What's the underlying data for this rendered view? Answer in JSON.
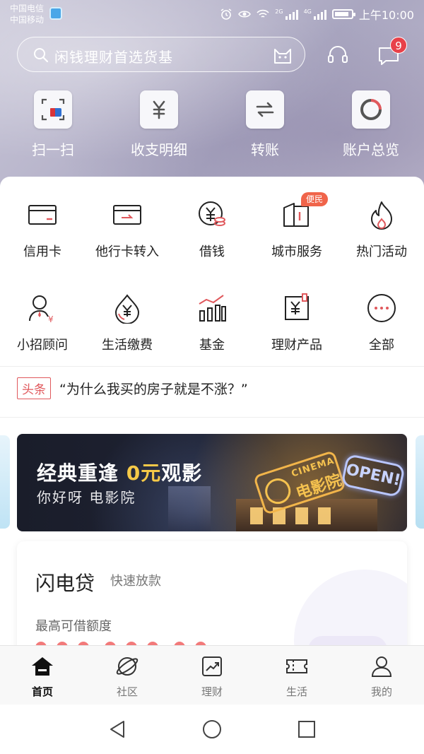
{
  "statusbar": {
    "carrier_1": "中国电信",
    "carrier_2": "中国移动",
    "net_1": "2G",
    "net_2": "4G",
    "time": "上午10:00",
    "battery_percent": 85
  },
  "search": {
    "placeholder": "闲钱理财首选货基",
    "message_badge": "9"
  },
  "quick_actions": [
    {
      "label": "扫一扫",
      "icon": "scan-icon"
    },
    {
      "label": "收支明细",
      "icon": "yuan-statement-icon"
    },
    {
      "label": "转账",
      "icon": "transfer-icon"
    },
    {
      "label": "账户总览",
      "icon": "account-overview-icon"
    }
  ],
  "services": [
    {
      "label": "信用卡",
      "icon": "credit-card-icon"
    },
    {
      "label": "他行卡转入",
      "icon": "card-transfer-in-icon"
    },
    {
      "label": "借钱",
      "icon": "borrow-coin-icon"
    },
    {
      "label": "城市服务",
      "icon": "city-service-icon",
      "tag": "便民"
    },
    {
      "label": "热门活动",
      "icon": "flame-icon"
    },
    {
      "label": "小招顾问",
      "icon": "advisor-icon"
    },
    {
      "label": "生活缴费",
      "icon": "utility-pay-icon"
    },
    {
      "label": "基金",
      "icon": "fund-chart-icon"
    },
    {
      "label": "理财产品",
      "icon": "wealth-product-icon"
    },
    {
      "label": "全部",
      "icon": "more-icon"
    }
  ],
  "headline": {
    "tag": "头条",
    "text": "“为什么我买的房子就是不涨？”"
  },
  "banner": {
    "title_pre": "经典重逢 ",
    "title_highlight": "0元",
    "title_post": "观影",
    "subtitle": "你好呀 电影院",
    "sign_word": "CINEMA",
    "sign_cn": "电影院",
    "open_sign": "OPEN!"
  },
  "loan": {
    "title": "闪电贷",
    "subtitle": "快速放款",
    "limit_label": "最高可借额度"
  },
  "tabs": [
    {
      "label": "首页",
      "icon": "home-icon",
      "active": true
    },
    {
      "label": "社区",
      "icon": "community-icon"
    },
    {
      "label": "理财",
      "icon": "wealth-icon"
    },
    {
      "label": "生活",
      "icon": "life-ticket-icon"
    },
    {
      "label": "我的",
      "icon": "profile-icon"
    }
  ],
  "colors": {
    "accent_red": "#e8414a",
    "tag_orange": "#f0644a",
    "banner_highlight": "#f5c948"
  }
}
